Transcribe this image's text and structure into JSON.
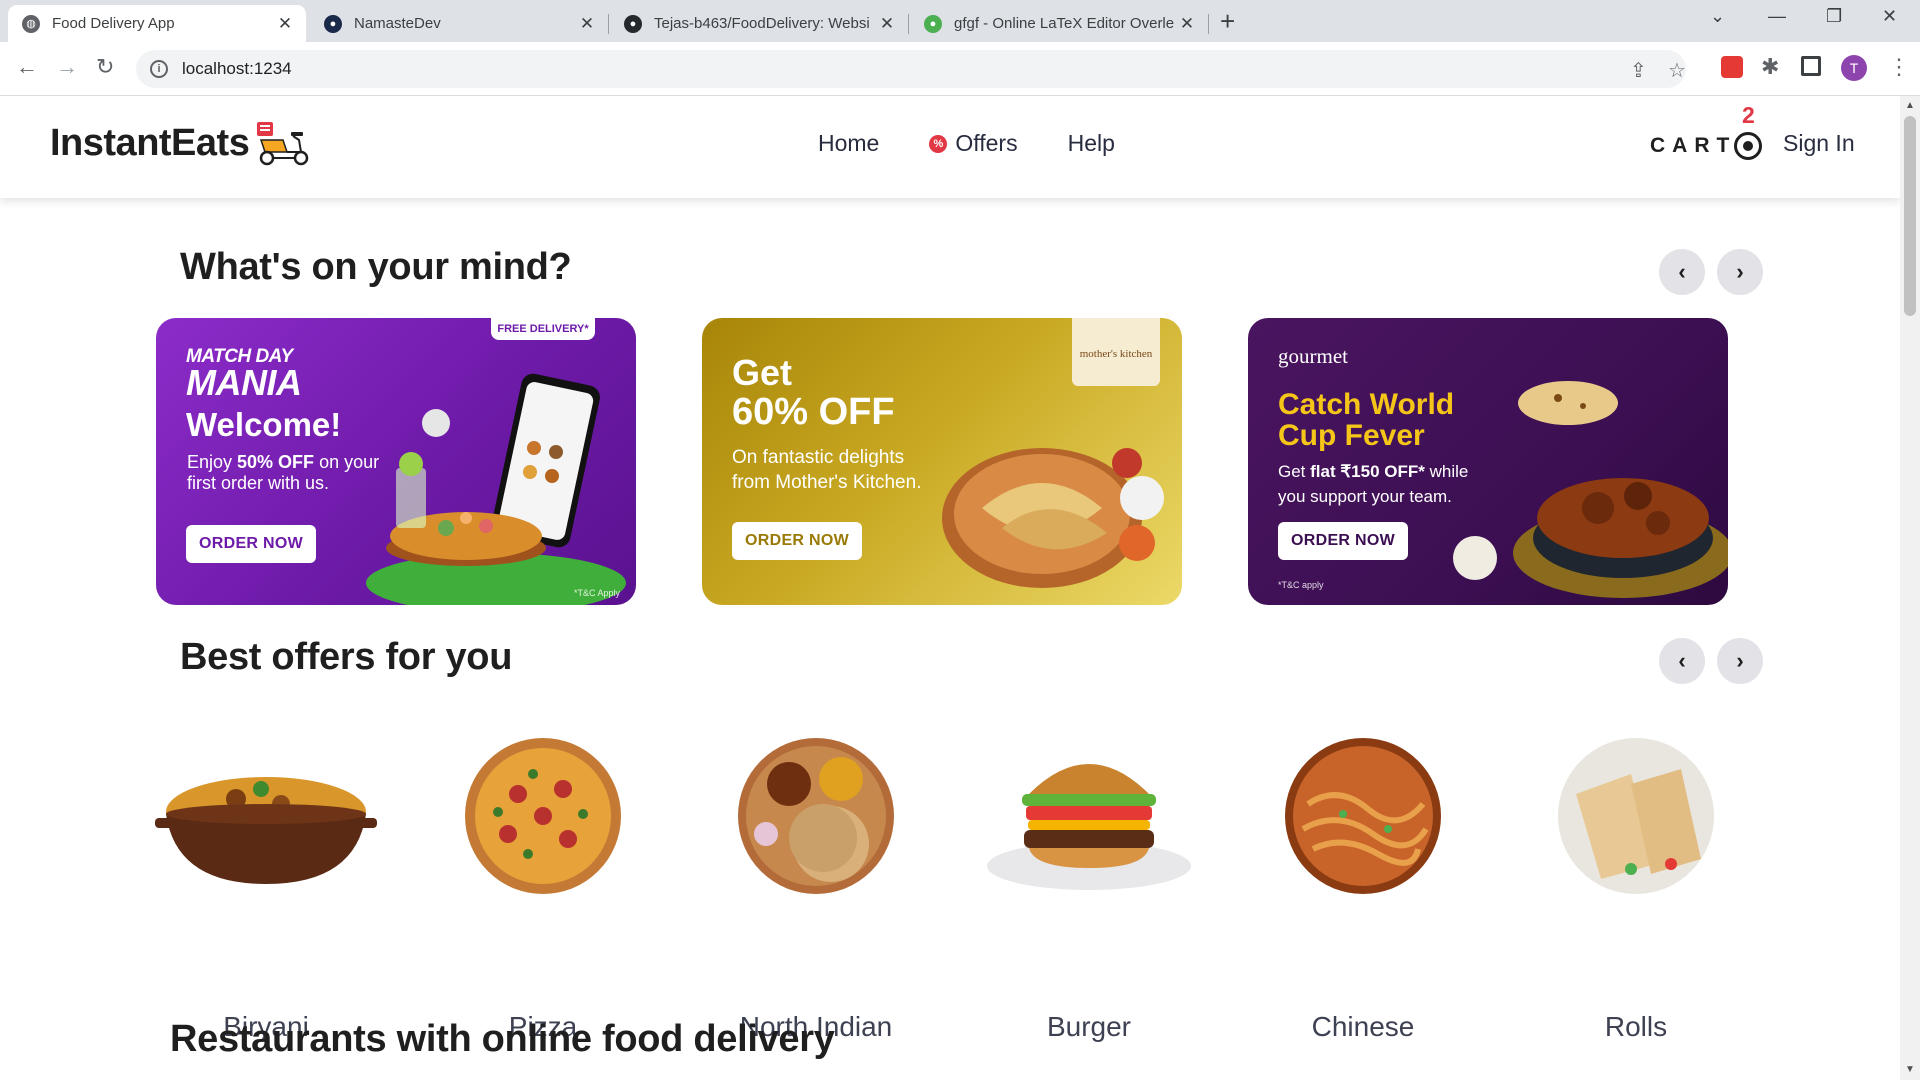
{
  "browser": {
    "tabs": [
      {
        "title": "Food Delivery App",
        "active": true
      },
      {
        "title": "NamasteDev",
        "active": false
      },
      {
        "title": "Tejas-b463/FoodDelivery: Websi",
        "active": false
      },
      {
        "title": "gfgf - Online LaTeX Editor Overle",
        "active": false
      }
    ],
    "url": "localhost:1234",
    "profile_initial": "T"
  },
  "header": {
    "logo_text": "InstantEats",
    "nav": {
      "home": "Home",
      "offers": "Offers",
      "help": "Help"
    },
    "offer_badge_symbol": "%",
    "cart_label": "CART",
    "cart_count": "2",
    "sign_in": "Sign In"
  },
  "sections": {
    "mind_title": "What's on your mind?",
    "offers_title": "Best offers for you",
    "restaurants_title": "Restaurants with online food delivery"
  },
  "banners": [
    {
      "tag": "FREE DELIVERY*",
      "brand_top": "MATCH DAY",
      "brand_bottom": "MANIA",
      "headline": "Welcome!",
      "line1_pre": "Enjoy ",
      "line1_bold": "50% OFF",
      "line1_post": " on your",
      "line2": "first order with us.",
      "cta": "ORDER NOW",
      "fine_print": "*T&C Apply"
    },
    {
      "headline1": "Get",
      "headline2": "60% OFF",
      "line1": "On fantastic delights",
      "line2": "from Mother's Kitchen.",
      "brand": "mother's kitchen",
      "cta": "ORDER NOW"
    },
    {
      "brand": "gourmet",
      "headline1": "Catch World",
      "headline2": "Cup Fever",
      "line1_pre": "Get ",
      "line1_bold": "flat ₹150 OFF*",
      "line1_post": " while",
      "line2": "you support your team.",
      "cta": "ORDER NOW",
      "fine_print": "*T&C apply"
    }
  ],
  "categories": [
    "Biryani",
    "Pizza",
    "North Indian",
    "Burger",
    "Chinese",
    "Rolls"
  ],
  "colors": {
    "accent_red": "#e23744",
    "text_dark": "#282c3f"
  }
}
